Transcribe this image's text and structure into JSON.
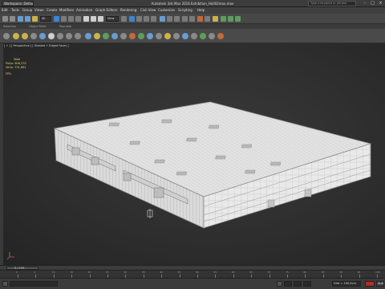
{
  "title_bar": {
    "workspace": "Workspace: Default",
    "title": "Autodesk 3ds Max 2016    Exhibition_Hall02max.max",
    "search_placeholder": "Type a keyword or phrase"
  },
  "menu": [
    "Edit",
    "Tools",
    "Group",
    "Views",
    "Create",
    "Modifiers",
    "Animation",
    "Graph Editors",
    "Rendering",
    "Civil View",
    "Customize",
    "Scripting",
    "Help"
  ],
  "toolbar": {
    "selection_filter": "All",
    "reference_coord": "View"
  },
  "ribbon_tabs": [
    "Selection",
    "Object Paint",
    "Populate"
  ],
  "viewport": {
    "label": "[ + ] [ Perspective ] [ Shaded + Edged Faces ]",
    "stats": {
      "total_label": "Total",
      "polys_label": "Polys:",
      "polys_value": "608,233",
      "verts_label": "Verts:",
      "verts_value": "751,681",
      "fps_label": "FPS:"
    }
  },
  "timeline": {
    "frame_label": "0 / 100",
    "ticks": [
      "0",
      "5",
      "10",
      "15",
      "20",
      "25",
      "30",
      "35",
      "40",
      "45",
      "50",
      "55",
      "60",
      "65",
      "70",
      "75",
      "80",
      "85",
      "90",
      "95",
      "100"
    ]
  },
  "status": {
    "grid": "Grid = 100,0cm",
    "auto_key": "Auto"
  },
  "colors": {
    "accent": "#3a86d4",
    "stats_text": "#e8d56a",
    "building": "#e6e6e6"
  }
}
